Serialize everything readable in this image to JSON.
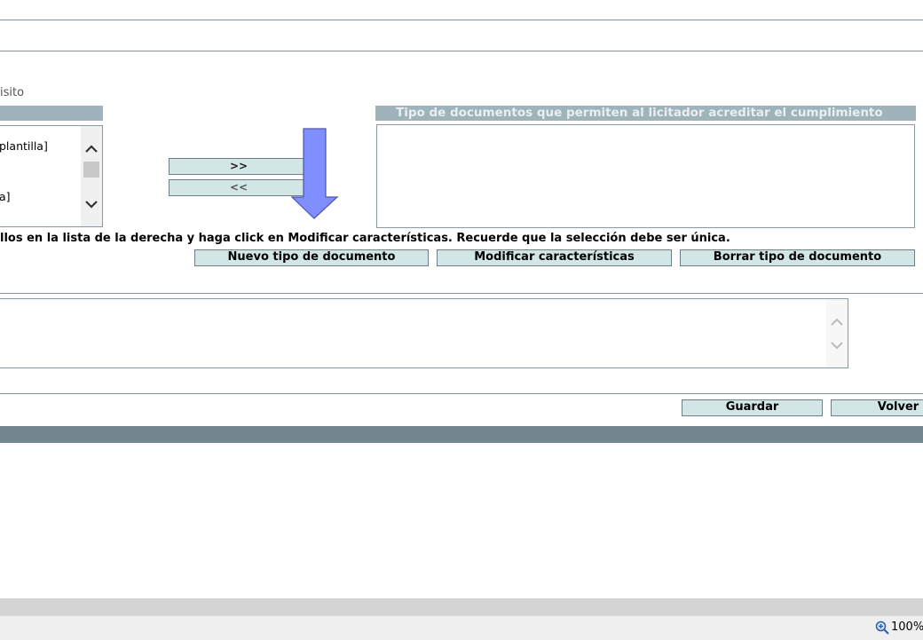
{
  "fragment_text": "isito",
  "left_list": {
    "items": [
      "plantilla]",
      "a]"
    ]
  },
  "transfer": {
    "add_label": ">>",
    "remove_label": "<<"
  },
  "right_panel": {
    "header": "Tipo de documentos que permiten al licitador acreditar el cumplimiento"
  },
  "instruction": "llos en la lista de la derecha y haga click en Modificar características. Recuerde que la selección debe ser única.",
  "doc_buttons": {
    "new_label": "Nuevo tipo de documento",
    "modify_label": "Modificar características",
    "delete_label": "Borrar tipo de documento"
  },
  "footer_buttons": {
    "save_label": "Guardar",
    "back_label": "Volver"
  },
  "status": {
    "zoom": "100%"
  },
  "colors": {
    "header_bg": "#9fb3bb",
    "button_bg": "#d3e6e6",
    "arrow_fill": "#7f8fff",
    "bottom_bar": "#73878e"
  },
  "icons": {
    "arrow": "down-arrow-icon",
    "zoom": "zoom-in-icon"
  }
}
